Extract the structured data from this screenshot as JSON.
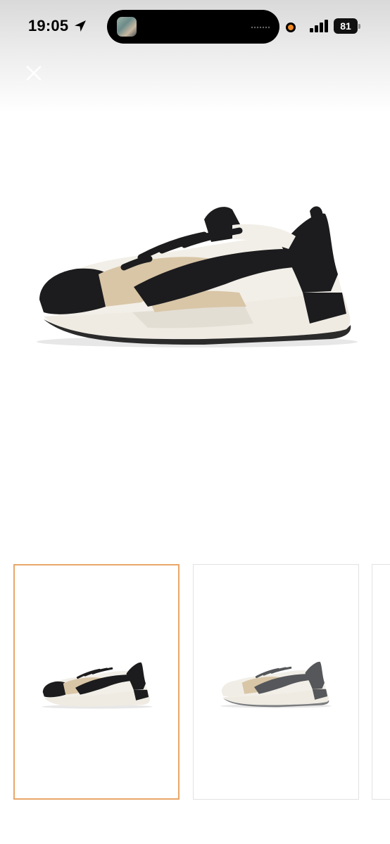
{
  "status_bar": {
    "time": "19:05",
    "location_icon": "location-arrow-icon",
    "battery_level": "81",
    "signal_icon": "cellular-signal-icon",
    "recording_indicator_color": "#f08a24"
  },
  "toolbar": {
    "close_icon": "close-icon"
  },
  "gallery": {
    "selected_index": 0,
    "thumbnails": [
      {
        "variant": "black-beige",
        "selected": true,
        "border_color": "#e9a668"
      },
      {
        "variant": "grey-beige",
        "selected": false
      },
      {
        "variant": "partial",
        "selected": false
      }
    ]
  },
  "colors": {
    "accent_border": "#e9a668",
    "shoe_black": "#1c1c1e",
    "shoe_beige": "#d9c6a7",
    "shoe_cream": "#f2efe8",
    "shoe_grey": "#55575a"
  }
}
